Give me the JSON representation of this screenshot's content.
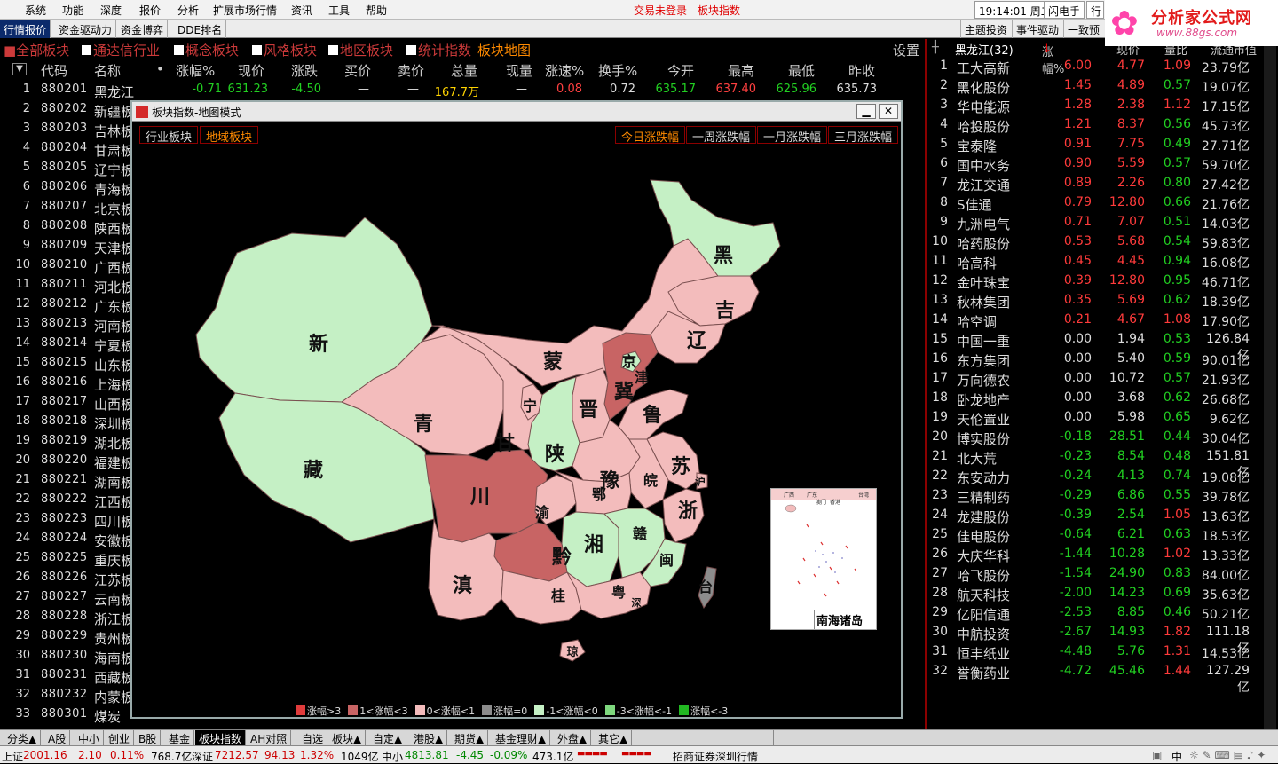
{
  "menubar": {
    "items": [
      "系统",
      "功能",
      "深度",
      "报价",
      "分析",
      "扩展市场行情",
      "资讯",
      "工具",
      "帮助"
    ],
    "trade_status": "交易未登录",
    "current_view": "板块指数",
    "clock": "19:14:01 周二",
    "flash": "闪电手",
    "flash2": "行"
  },
  "logo": {
    "name": "分析家公式网",
    "url": "www.88gs.com"
  },
  "tabbar": {
    "left": [
      "行情报价",
      "资金驱动力",
      "资金博弈",
      "DDE排名"
    ],
    "right": [
      "主题投资",
      "事件驱动",
      "一致预"
    ]
  },
  "filterbar": {
    "items": [
      "全部板块",
      "通达信行业",
      "概念板块",
      "风格板块",
      "地区板块",
      "统计指数"
    ],
    "active_label": "板块地图",
    "settings": "设置"
  },
  "table": {
    "headers": [
      "代码",
      "名称",
      "•",
      "涨幅%",
      "现价",
      "涨跌",
      "买价",
      "卖价",
      "总量",
      "现量",
      "涨速%",
      "换手%",
      "今开",
      "最高",
      "最低",
      "昨收"
    ],
    "rows": [
      {
        "n": "1",
        "code": "880201",
        "name": "黑龙江",
        "chg": "-0.71",
        "price": "631.23",
        "diff": "-4.50",
        "bid": "—",
        "ask": "—",
        "vol": "167.7万",
        "cur": "—",
        "spd": "0.08",
        "turn": "0.72",
        "open": "635.17",
        "high": "637.40",
        "low": "625.96",
        "prev": "635.73"
      },
      {
        "n": "2",
        "code": "880202",
        "name": "新疆板"
      },
      {
        "n": "3",
        "code": "880203",
        "name": "吉林板"
      },
      {
        "n": "4",
        "code": "880204",
        "name": "甘肃板"
      },
      {
        "n": "5",
        "code": "880205",
        "name": "辽宁板"
      },
      {
        "n": "6",
        "code": "880206",
        "name": "青海板"
      },
      {
        "n": "7",
        "code": "880207",
        "name": "北京板"
      },
      {
        "n": "8",
        "code": "880208",
        "name": "陕西板"
      },
      {
        "n": "9",
        "code": "880209",
        "name": "天津板"
      },
      {
        "n": "10",
        "code": "880210",
        "name": "广西板"
      },
      {
        "n": "11",
        "code": "880211",
        "name": "河北板"
      },
      {
        "n": "12",
        "code": "880212",
        "name": "广东板"
      },
      {
        "n": "13",
        "code": "880213",
        "name": "河南板"
      },
      {
        "n": "14",
        "code": "880214",
        "name": "宁夏板"
      },
      {
        "n": "15",
        "code": "880215",
        "name": "山东板"
      },
      {
        "n": "16",
        "code": "880216",
        "name": "上海板"
      },
      {
        "n": "17",
        "code": "880217",
        "name": "山西板"
      },
      {
        "n": "18",
        "code": "880218",
        "name": "深圳板"
      },
      {
        "n": "19",
        "code": "880219",
        "name": "湖北板"
      },
      {
        "n": "20",
        "code": "880220",
        "name": "福建板"
      },
      {
        "n": "21",
        "code": "880221",
        "name": "湖南板"
      },
      {
        "n": "22",
        "code": "880222",
        "name": "江西板"
      },
      {
        "n": "23",
        "code": "880223",
        "name": "四川板"
      },
      {
        "n": "24",
        "code": "880224",
        "name": "安徽板"
      },
      {
        "n": "25",
        "code": "880225",
        "name": "重庆板"
      },
      {
        "n": "26",
        "code": "880226",
        "name": "江苏板"
      },
      {
        "n": "27",
        "code": "880227",
        "name": "云南板"
      },
      {
        "n": "28",
        "code": "880228",
        "name": "浙江板"
      },
      {
        "n": "29",
        "code": "880229",
        "name": "贵州板"
      },
      {
        "n": "30",
        "code": "880230",
        "name": "海南板"
      },
      {
        "n": "31",
        "code": "880231",
        "name": "西藏板"
      },
      {
        "n": "32",
        "code": "880232",
        "name": "内蒙板"
      },
      {
        "n": "33",
        "code": "880301",
        "name": "煤炭"
      }
    ]
  },
  "right_panel": {
    "title": "黑龙江(32)",
    "headers": [
      "涨幅%",
      "现价",
      "量比",
      "流通市值"
    ],
    "rows": [
      {
        "n": "1",
        "name": "工大高新",
        "chg": "6.00",
        "price": "4.77",
        "vr": "1.09",
        "mc": "23.79亿"
      },
      {
        "n": "2",
        "name": "黑化股份",
        "chg": "1.45",
        "price": "4.89",
        "vr": "0.57",
        "mc": "19.07亿"
      },
      {
        "n": "3",
        "name": "华电能源",
        "chg": "1.28",
        "price": "2.38",
        "vr": "1.12",
        "mc": "17.15亿"
      },
      {
        "n": "4",
        "name": "哈投股份",
        "chg": "1.21",
        "price": "8.37",
        "vr": "0.56",
        "mc": "45.73亿"
      },
      {
        "n": "5",
        "name": "宝泰隆",
        "chg": "0.91",
        "price": "7.75",
        "vr": "0.49",
        "mc": "27.71亿"
      },
      {
        "n": "6",
        "name": "国中水务",
        "chg": "0.90",
        "price": "5.59",
        "vr": "0.57",
        "mc": "59.70亿"
      },
      {
        "n": "7",
        "name": "龙江交通",
        "chg": "0.89",
        "price": "2.26",
        "vr": "0.80",
        "mc": "27.42亿"
      },
      {
        "n": "8",
        "name": "S佳通",
        "chg": "0.79",
        "price": "12.80",
        "vr": "0.66",
        "mc": "21.76亿"
      },
      {
        "n": "9",
        "name": "九洲电气",
        "chg": "0.71",
        "price": "7.07",
        "vr": "0.51",
        "mc": "14.03亿"
      },
      {
        "n": "10",
        "name": "哈药股份",
        "chg": "0.53",
        "price": "5.68",
        "vr": "0.54",
        "mc": "59.83亿"
      },
      {
        "n": "11",
        "name": "哈高科",
        "chg": "0.45",
        "price": "4.45",
        "vr": "0.94",
        "mc": "16.08亿"
      },
      {
        "n": "12",
        "name": "金叶珠宝",
        "chg": "0.39",
        "price": "12.80",
        "vr": "0.95",
        "mc": "46.71亿"
      },
      {
        "n": "13",
        "name": "秋林集团",
        "chg": "0.35",
        "price": "5.69",
        "vr": "0.62",
        "mc": "18.39亿"
      },
      {
        "n": "14",
        "name": "哈空调",
        "chg": "0.21",
        "price": "4.67",
        "vr": "1.08",
        "mc": "17.90亿"
      },
      {
        "n": "15",
        "name": "中国一重",
        "chg": "0.00",
        "price": "1.94",
        "vr": "0.53",
        "mc": "126.84亿"
      },
      {
        "n": "16",
        "name": "东方集团",
        "chg": "0.00",
        "price": "5.40",
        "vr": "0.59",
        "mc": "90.01亿"
      },
      {
        "n": "17",
        "name": "万向德农",
        "chg": "0.00",
        "price": "10.72",
        "vr": "0.57",
        "mc": "21.93亿"
      },
      {
        "n": "18",
        "name": "卧龙地产",
        "chg": "0.00",
        "price": "3.68",
        "vr": "0.62",
        "mc": "26.68亿"
      },
      {
        "n": "19",
        "name": "天伦置业",
        "chg": "0.00",
        "price": "5.98",
        "vr": "0.65",
        "mc": "9.62亿"
      },
      {
        "n": "20",
        "name": "博实股份",
        "chg": "-0.18",
        "price": "28.51",
        "vr": "0.44",
        "mc": "30.04亿"
      },
      {
        "n": "21",
        "name": "北大荒",
        "chg": "-0.23",
        "price": "8.54",
        "vr": "0.48",
        "mc": "151.81亿"
      },
      {
        "n": "22",
        "name": "东安动力",
        "chg": "-0.24",
        "price": "4.13",
        "vr": "0.74",
        "mc": "19.08亿"
      },
      {
        "n": "23",
        "name": "三精制药",
        "chg": "-0.29",
        "price": "6.86",
        "vr": "0.55",
        "mc": "39.78亿"
      },
      {
        "n": "24",
        "name": "龙建股份",
        "chg": "-0.39",
        "price": "2.54",
        "vr": "1.05",
        "mc": "13.63亿"
      },
      {
        "n": "25",
        "name": "佳电股份",
        "chg": "-0.64",
        "price": "6.21",
        "vr": "0.63",
        "mc": "18.53亿"
      },
      {
        "n": "26",
        "name": "大庆华科",
        "chg": "-1.44",
        "price": "10.28",
        "vr": "1.02",
        "mc": "13.33亿"
      },
      {
        "n": "27",
        "name": "哈飞股份",
        "chg": "-1.54",
        "price": "24.90",
        "vr": "0.83",
        "mc": "84.00亿"
      },
      {
        "n": "28",
        "name": "航天科技",
        "chg": "-2.00",
        "price": "14.23",
        "vr": "0.69",
        "mc": "35.63亿"
      },
      {
        "n": "29",
        "name": "亿阳信通",
        "chg": "-2.53",
        "price": "8.85",
        "vr": "0.46",
        "mc": "50.21亿"
      },
      {
        "n": "30",
        "name": "中航投资",
        "chg": "-2.67",
        "price": "14.93",
        "vr": "1.82",
        "mc": "111.18亿"
      },
      {
        "n": "31",
        "name": "恒丰纸业",
        "chg": "-4.48",
        "price": "5.76",
        "vr": "1.31",
        "mc": "14.53亿"
      },
      {
        "n": "32",
        "name": "誉衡药业",
        "chg": "-4.72",
        "price": "45.46",
        "vr": "1.44",
        "mc": "127.29亿"
      }
    ]
  },
  "modal": {
    "title": "板块指数-地图模式",
    "tabs": [
      "行业板块",
      "地域板块"
    ],
    "ranges": [
      "今日涨跌幅",
      "一周涨跌幅",
      "一月涨跌幅",
      "三月涨跌幅"
    ],
    "inset_label": "南海诸岛",
    "inset_tiny": [
      "广西",
      "广东",
      "台湾",
      "澳门",
      "香港"
    ],
    "legend": [
      {
        "label": "涨幅>3",
        "color": "#e03c3c"
      },
      {
        "label": "1<涨幅<3",
        "color": "#c86464"
      },
      {
        "label": "0<涨幅<1",
        "color": "#f3bcbc"
      },
      {
        "label": "涨幅=0",
        "color": "#8c8c8c"
      },
      {
        "label": "-1<涨幅<0",
        "color": "#c5f0c5"
      },
      {
        "label": "-3<涨幅<-1",
        "color": "#7ed87e"
      },
      {
        "label": "涨幅<-3",
        "color": "#22b822"
      }
    ],
    "provinces": {
      "xin": "新",
      "zang": "藏",
      "qing": "青",
      "gan": "甘",
      "meng": "蒙",
      "hei": "黑",
      "ji": "吉",
      "liao": "辽",
      "jing": "京",
      "jin_tj": "津",
      "hebei": "冀",
      "shanxi": "晋",
      "ning": "宁",
      "shaanxi": "陕",
      "lu": "鲁",
      "yu": "豫",
      "su": "苏",
      "wan": "皖",
      "hu": "沪",
      "chuan": "川",
      "yu_cq": "渝",
      "e": "鄂",
      "zhe": "浙",
      "xiang": "湘",
      "gan_jx": "赣",
      "qian": "黔",
      "min": "闽",
      "tai": "台",
      "dian": "滇",
      "gui": "桂",
      "yue": "粤",
      "shen": "深",
      "qiong": "琼"
    }
  },
  "bottom_tabs": [
    "分类▲",
    "A股",
    "中小",
    "创业",
    "B股",
    "基金",
    "板块指数",
    "AH对照",
    "自选",
    "板块▲",
    "自定▲",
    "港股▲",
    "期货▲",
    "基金理财▲",
    "外盘▲",
    "其它▲"
  ],
  "status": {
    "sh_label": "上证",
    "sh_val": "2001.16",
    "sh_diff": "2.10",
    "sh_pct": "0.11%",
    "sh_amt": "768.7亿",
    "sz_label": "深证",
    "sz_val": "7212.57",
    "sz_diff": "94.13",
    "sz_pct": "1.32%",
    "sz_amt": "1049亿",
    "zx_label": "中小",
    "zx_val": "4813.81",
    "zx_diff": "-4.45",
    "zx_pct": "-0.09%",
    "zx_amt": "473.1亿",
    "broker": "招商证券深圳行情",
    "right_text": "中"
  }
}
